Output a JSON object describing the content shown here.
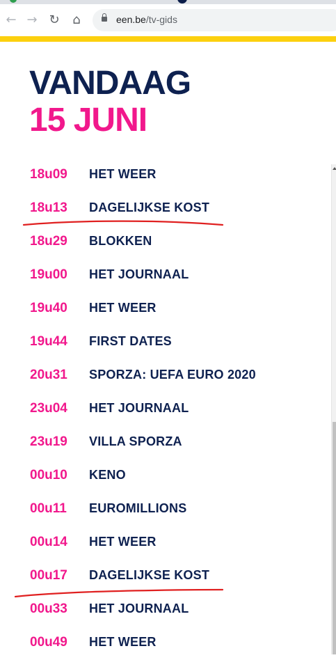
{
  "browser": {
    "url_domain": "een.be",
    "url_path": "/tv-gids"
  },
  "page": {
    "title_line1": "VANDAAG",
    "title_line2": "15 JUNI"
  },
  "colors": {
    "brand_navy": "#0e2150",
    "brand_pink": "#f1188c",
    "brand_yellow": "#fcd00e",
    "annotation_red": "#e02020"
  },
  "schedule": [
    {
      "time": "18u09",
      "title": "HET WEER"
    },
    {
      "time": "18u13",
      "title": "DAGELIJKSE KOST"
    },
    {
      "time": "18u29",
      "title": "BLOKKEN"
    },
    {
      "time": "19u00",
      "title": "HET JOURNAAL"
    },
    {
      "time": "19u40",
      "title": "HET WEER"
    },
    {
      "time": "19u44",
      "title": "FIRST DATES"
    },
    {
      "time": "20u31",
      "title": "SPORZA: UEFA EURO 2020"
    },
    {
      "time": "23u04",
      "title": "HET JOURNAAL"
    },
    {
      "time": "23u19",
      "title": "VILLA SPORZA"
    },
    {
      "time": "00u10",
      "title": "KENO"
    },
    {
      "time": "00u11",
      "title": "EUROMILLIONS"
    },
    {
      "time": "00u14",
      "title": "HET WEER"
    },
    {
      "time": "00u17",
      "title": "DAGELIJKSE KOST"
    },
    {
      "time": "00u33",
      "title": "HET JOURNAAL"
    },
    {
      "time": "00u49",
      "title": "HET WEER"
    }
  ]
}
